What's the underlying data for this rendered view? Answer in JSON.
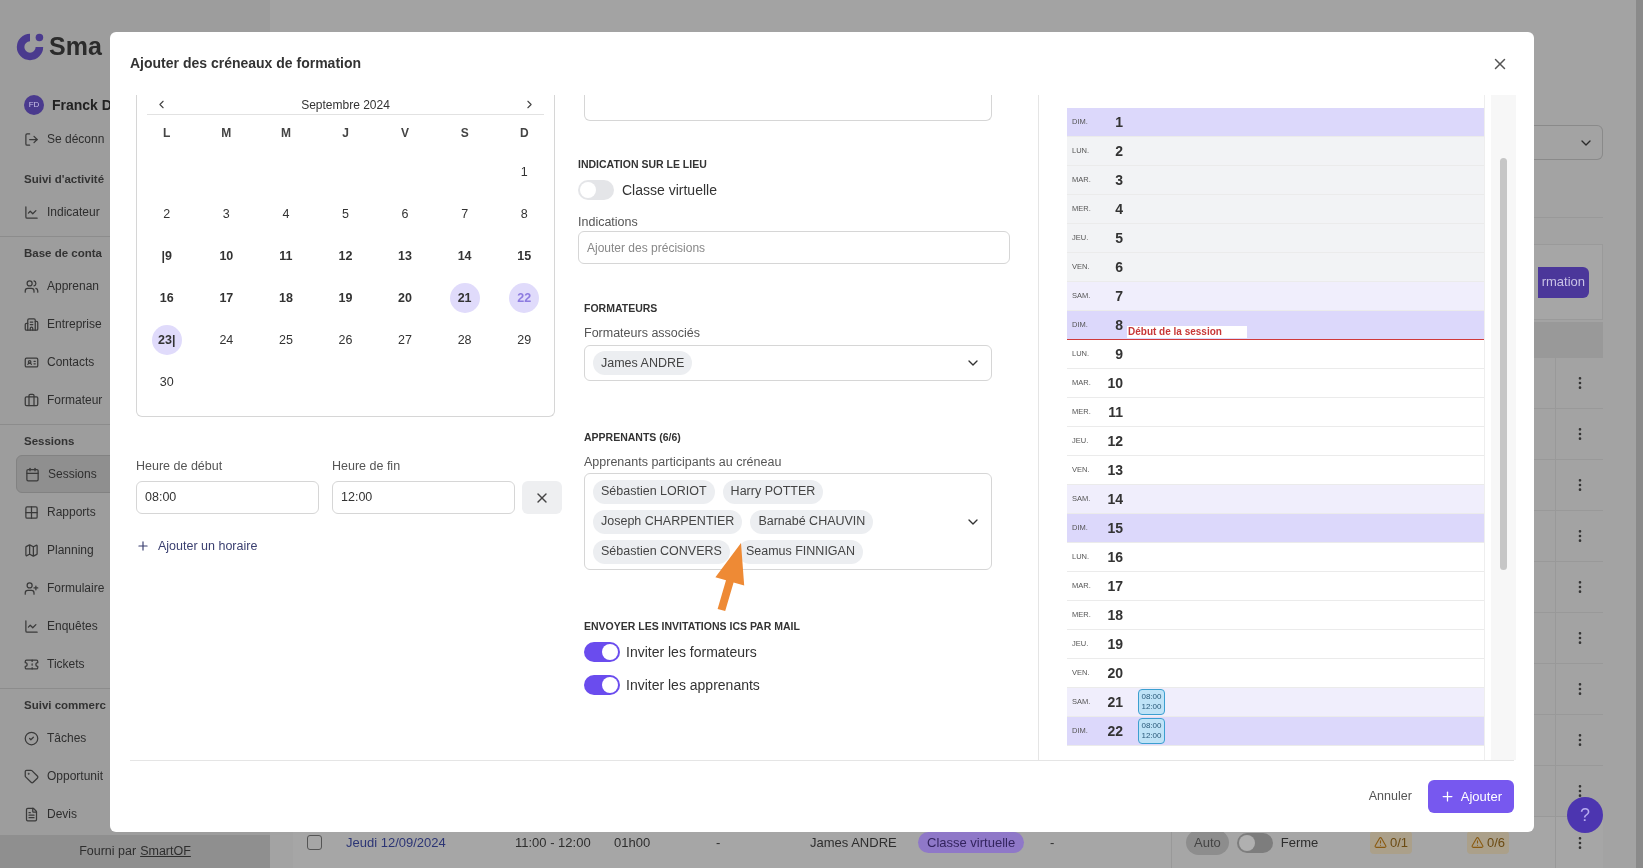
{
  "sidebar": {
    "logo": "Sma",
    "user": {
      "initials": "FD",
      "name": "Franck D"
    },
    "items": [
      {
        "kind": "link",
        "label": "Se déconn",
        "selected": false
      },
      {
        "kind": "section",
        "label": "Suivi d'activité"
      },
      {
        "kind": "link",
        "label": "Indicateur",
        "selected": false
      },
      {
        "kind": "section",
        "label": "Base de conta"
      },
      {
        "kind": "link",
        "label": "Apprenan",
        "selected": false
      },
      {
        "kind": "link",
        "label": "Entreprise",
        "selected": false
      },
      {
        "kind": "link",
        "label": "Contacts",
        "selected": false
      },
      {
        "kind": "link",
        "label": "Formateur",
        "selected": false
      },
      {
        "kind": "section",
        "label": "Sessions"
      },
      {
        "kind": "link",
        "label": "Sessions",
        "selected": true
      },
      {
        "kind": "link",
        "label": "Rapports",
        "selected": false
      },
      {
        "kind": "link",
        "label": "Planning",
        "selected": false
      },
      {
        "kind": "link",
        "label": "Formulaire",
        "selected": false
      },
      {
        "kind": "link",
        "label": "Enquêtes",
        "selected": false
      },
      {
        "kind": "link",
        "label": "Tickets",
        "selected": false
      },
      {
        "kind": "section",
        "label": "Suivi commerc"
      },
      {
        "kind": "link",
        "label": "Tâches",
        "selected": false
      },
      {
        "kind": "link",
        "label": "Opportunit",
        "selected": false
      },
      {
        "kind": "link",
        "label": "Devis",
        "selected": false
      }
    ],
    "footer": {
      "prefix": "Fourni par",
      "link": "SmartOF"
    }
  },
  "page": {
    "action_button": "rmation",
    "help": "?",
    "row": {
      "checked": false,
      "date": "Jeudi 12/09/2024",
      "time": "11:00 - 12:00",
      "duration": "01h00",
      "column_4": "-",
      "trainer": "James ANDRE",
      "place": "Classe virtuelle",
      "column_8": "-",
      "mode": "Auto",
      "toggle_on": false,
      "status": "Ferme",
      "trainers_count": "0/1",
      "learners_count": "0/6"
    }
  },
  "modal": {
    "title": "Ajouter des créneaux de formation",
    "calendar": {
      "month": "Septembre 2024",
      "weekdays": [
        "L",
        "M",
        "M",
        "J",
        "V",
        "S",
        "D"
      ],
      "weeks": [
        [
          {
            "d": "1",
            "in_range": false,
            "selected": false,
            "today": false
          }
        ],
        [
          {
            "d": "2",
            "in_range": false,
            "selected": false,
            "today": false
          },
          {
            "d": "3",
            "in_range": false,
            "selected": false,
            "today": false
          },
          {
            "d": "4",
            "in_range": false,
            "selected": false,
            "today": false
          },
          {
            "d": "5",
            "in_range": false,
            "selected": false,
            "today": false
          },
          {
            "d": "6",
            "in_range": false,
            "selected": false,
            "today": false
          },
          {
            "d": "7",
            "in_range": false,
            "selected": false,
            "today": false
          },
          {
            "d": "8",
            "in_range": false,
            "selected": false,
            "today": false
          }
        ],
        [
          {
            "d": "|9",
            "in_range": true,
            "selected": false,
            "today": false
          },
          {
            "d": "10",
            "in_range": true,
            "selected": false,
            "today": false
          },
          {
            "d": "11",
            "in_range": true,
            "selected": false,
            "today": false
          },
          {
            "d": "12",
            "in_range": true,
            "selected": false,
            "today": false
          },
          {
            "d": "13",
            "in_range": true,
            "selected": false,
            "today": false
          },
          {
            "d": "14",
            "in_range": true,
            "selected": false,
            "today": false
          },
          {
            "d": "15",
            "in_range": true,
            "selected": false,
            "today": false
          }
        ],
        [
          {
            "d": "16",
            "in_range": true,
            "selected": false,
            "today": false
          },
          {
            "d": "17",
            "in_range": true,
            "selected": false,
            "today": false
          },
          {
            "d": "18",
            "in_range": true,
            "selected": false,
            "today": false
          },
          {
            "d": "19",
            "in_range": true,
            "selected": false,
            "today": false
          },
          {
            "d": "20",
            "in_range": true,
            "selected": false,
            "today": false
          },
          {
            "d": "21",
            "in_range": true,
            "selected": true,
            "today": false
          },
          {
            "d": "22",
            "in_range": true,
            "selected": true,
            "today": true
          }
        ],
        [
          {
            "d": "23|",
            "in_range": true,
            "selected": true,
            "today": false
          },
          {
            "d": "24",
            "in_range": false,
            "selected": false,
            "today": false
          },
          {
            "d": "25",
            "in_range": false,
            "selected": false,
            "today": false
          },
          {
            "d": "26",
            "in_range": false,
            "selected": false,
            "today": false
          },
          {
            "d": "27",
            "in_range": false,
            "selected": false,
            "today": false
          },
          {
            "d": "28",
            "in_range": false,
            "selected": false,
            "today": false
          },
          {
            "d": "29",
            "in_range": false,
            "selected": false,
            "today": false
          }
        ],
        [
          {
            "d": "30",
            "in_range": false,
            "selected": false,
            "today": false
          }
        ]
      ]
    },
    "time": {
      "start_label": "Heure de début",
      "start": "08:00",
      "end_label": "Heure de fin",
      "end": "12:00",
      "add_label": "Ajouter un horaire"
    },
    "location": {
      "heading": "INDICATION SUR LE LIEU",
      "virtual": {
        "label": "Classe virtuelle",
        "on": false
      },
      "indications_label": "Indications",
      "indications_placeholder": "Ajouter des précisions"
    },
    "trainers": {
      "heading": "FORMATEURS",
      "label": "Formateurs associés",
      "chips": [
        "James ANDRE"
      ]
    },
    "learners": {
      "heading": "APPRENANTS (6/6)",
      "label": "Apprenants participants au créneau",
      "chips": [
        "Sébastien LORIOT",
        "Harry POTTER",
        "Joseph CHARPENTIER",
        "Barnabé CHAUVIN",
        "Sébastien CONVERS",
        "Seamus FINNIGAN"
      ]
    },
    "invitations": {
      "heading": "ENVOYER LES INVITATIONS ICS PAR MAIL",
      "toggles": [
        {
          "label": "Inviter les formateurs",
          "on": true
        },
        {
          "label": "Inviter les apprenants",
          "on": true
        }
      ]
    },
    "agenda": [
      {
        "dow": "DIM.",
        "day": "1",
        "kind": "sunday"
      },
      {
        "dow": "LUN.",
        "day": "2",
        "kind": "past"
      },
      {
        "dow": "MAR.",
        "day": "3",
        "kind": "past"
      },
      {
        "dow": "MER.",
        "day": "4",
        "kind": "past"
      },
      {
        "dow": "JEU.",
        "day": "5",
        "kind": "past"
      },
      {
        "dow": "VEN.",
        "day": "6",
        "kind": "past"
      },
      {
        "dow": "SAM.",
        "day": "7",
        "kind": "saturday"
      },
      {
        "dow": "DIM.",
        "day": "8",
        "kind": "sunday",
        "marker": "Début de la session"
      },
      {
        "dow": "LUN.",
        "day": "9",
        "kind": "weekday"
      },
      {
        "dow": "MAR.",
        "day": "10",
        "kind": "weekday"
      },
      {
        "dow": "MER.",
        "day": "11",
        "kind": "weekday"
      },
      {
        "dow": "JEU.",
        "day": "12",
        "kind": "weekday"
      },
      {
        "dow": "VEN.",
        "day": "13",
        "kind": "weekday"
      },
      {
        "dow": "SAM.",
        "day": "14",
        "kind": "saturday"
      },
      {
        "dow": "DIM.",
        "day": "15",
        "kind": "sunday"
      },
      {
        "dow": "LUN.",
        "day": "16",
        "kind": "weekday"
      },
      {
        "dow": "MAR.",
        "day": "17",
        "kind": "weekday"
      },
      {
        "dow": "MER.",
        "day": "18",
        "kind": "weekday"
      },
      {
        "dow": "JEU.",
        "day": "19",
        "kind": "weekday"
      },
      {
        "dow": "VEN.",
        "day": "20",
        "kind": "weekday"
      },
      {
        "dow": "SAM.",
        "day": "21",
        "kind": "saturday",
        "events": [
          {
            "start": "08:00",
            "end": "12:00"
          }
        ]
      },
      {
        "dow": "DIM.",
        "day": "22",
        "kind": "sunday",
        "events": [
          {
            "start": "08:00",
            "end": "12:00"
          }
        ]
      }
    ],
    "footer": {
      "cancel": "Annuler",
      "submit": "Ajouter"
    }
  }
}
